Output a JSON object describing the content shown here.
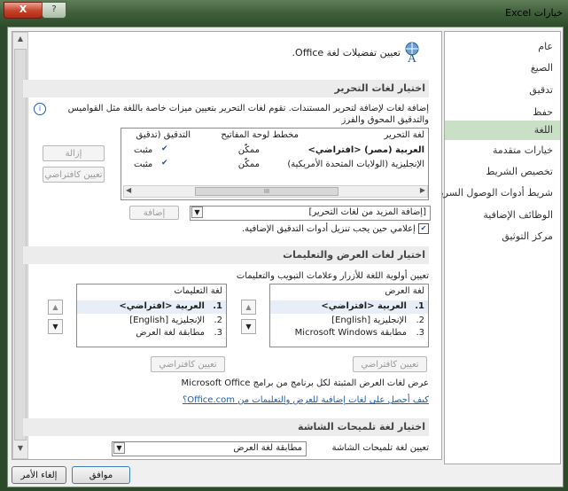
{
  "window": {
    "title": "خيارات Excel",
    "close_label": "X",
    "help_label": "?"
  },
  "nav": {
    "items": [
      "عام",
      "الصيغ",
      "تدقيق",
      "حفظ",
      "اللغة",
      "خيارات متقدمة",
      "تخصيص الشريط",
      "شريط أدوات الوصول السريع",
      "الوظائف الإضافية",
      "مركز التوثيق"
    ],
    "selected": "اللغة"
  },
  "header": {
    "title": "تعيين تفضيلات لغة Office."
  },
  "editing": {
    "section_title": "اختيار لغات التحرير",
    "description": "إضافة لغات لإضافة لتحرير المستندات. تقوم لغات التحرير بتعيين ميزات خاصة باللغة مثل القواميس والتدقيق المحوق والفرز",
    "columns": [
      "لغة التحرير",
      "مخطط لوحة المفاتيح",
      "التدقيق (تدقيق"
    ],
    "rows": [
      {
        "language": "العربية (مصر) <افتراضي>",
        "keyboard": "ممكّن",
        "proofing": "مثبت"
      },
      {
        "language": "الإنجليزية (الولايات المتحدة الأمريكية)",
        "keyboard": "ممكّن",
        "proofing": "مثبت"
      }
    ],
    "scroll_mid": "III",
    "remove_label": "إزالة",
    "set_default_label": "تعيين كافتراضي",
    "add_more": "[إضافة المزيد من لغات التحرير]",
    "add_label": "إضافة",
    "notify": "إعلامي حين يجب تنزيل أدوات التدقيق الإضافية."
  },
  "display": {
    "section_title": "اختيار لغات العرض والتعليمات",
    "description": "تعيين أولوية اللغة للأزرار وعلامات التبويب والتعليمات",
    "display_list": {
      "title": "لغة العرض",
      "items": [
        {
          "n": "1.",
          "label": "العربية <افتراضي>"
        },
        {
          "n": "2.",
          "label": "الإنجليزية [English]"
        },
        {
          "n": "3.",
          "label": "مطابقة Microsoft Windows"
        }
      ]
    },
    "help_list": {
      "title": "لغة التعليمات",
      "items": [
        {
          "n": "1.",
          "label": "العربية <افتراضي>"
        },
        {
          "n": "2.",
          "label": "الإنجليزية [English]"
        },
        {
          "n": "3.",
          "label": "مطابقة لغة العرض"
        }
      ]
    },
    "set_default_label": "تعيين كافتراضي",
    "view_installed": "عرض لغات العرض المثبتة لكل برنامج من برامج Microsoft Office",
    "link": "كيف أحصل على لغات إضافية للعرض والتعليمات من Office.com؟"
  },
  "screentip": {
    "section_title": "اختيار لغة تلميحات الشاشة",
    "label": "تعيين لغة تلميحات الشاشة",
    "value": "مطابقة لغة العرض"
  },
  "footer": {
    "ok": "موافق",
    "cancel": "إلغاء الأمر"
  }
}
